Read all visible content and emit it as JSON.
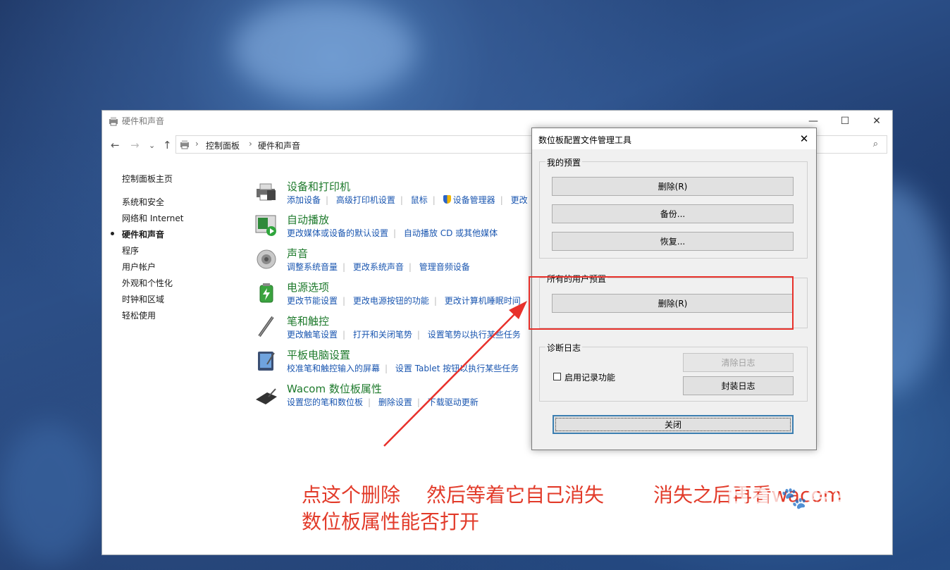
{
  "window": {
    "title": "硬件和声音"
  },
  "address": {
    "crumbs": [
      "控制面板",
      "硬件和声音"
    ]
  },
  "sidebar": {
    "items": [
      {
        "label": "控制面板主页"
      },
      {
        "label": "系统和安全"
      },
      {
        "label": "网络和 Internet"
      },
      {
        "label": "硬件和声音",
        "active": true
      },
      {
        "label": "程序"
      },
      {
        "label": "用户帐户"
      },
      {
        "label": "外观和个性化"
      },
      {
        "label": "时钟和区域"
      },
      {
        "label": "轻松使用"
      }
    ]
  },
  "categories": [
    {
      "title": "设备和打印机",
      "icon": "printer-icon",
      "links": [
        "添加设备",
        "高级打印机设置",
        "鼠标",
        "设备管理器",
        "更改"
      ]
    },
    {
      "title": "自动播放",
      "icon": "autoplay-icon",
      "links": [
        "更改媒体或设备的默认设置",
        "自动播放 CD 或其他媒体"
      ]
    },
    {
      "title": "声音",
      "icon": "speaker-icon",
      "links": [
        "调整系统音量",
        "更改系统声音",
        "管理音频设备"
      ]
    },
    {
      "title": "电源选项",
      "icon": "battery-icon",
      "links": [
        "更改节能设置",
        "更改电源按钮的功能",
        "更改计算机睡眠时间"
      ]
    },
    {
      "title": "笔和触控",
      "icon": "pen-icon",
      "links": [
        "更改触笔设置",
        "打开和关闭笔势",
        "设置笔势以执行某些任务"
      ]
    },
    {
      "title": "平板电脑设置",
      "icon": "tablet-icon",
      "links": [
        "校准笔和触控输入的屏幕",
        "设置 Tablet 按钮以执行某些任务"
      ]
    },
    {
      "title": "Wacom 数位板属性",
      "icon": "wacom-tablet-icon",
      "links": [
        "设置您的笔和数位板",
        "删除设置",
        "下载驱动更新"
      ]
    }
  ],
  "dialog": {
    "title": "数位板配置文件管理工具",
    "my_prefs": {
      "label": "我的预置",
      "delete": "删除(R)",
      "backup": "备份...",
      "restore": "恢复..."
    },
    "all_users": {
      "label": "所有的用户预置",
      "delete": "删除(R)"
    },
    "diag": {
      "label": "诊断日志",
      "enable_logging": "启用记录功能",
      "clear_log": "清除日志",
      "package_log": "封装日志"
    },
    "close": "关闭"
  },
  "annotation": {
    "line1_a": "点这个删除",
    "line1_b": "然后等着它自己消失",
    "line1_c": "消失之后再看wacom",
    "line2": "数位板属性能否打开",
    "color": "#e23b2a"
  },
  "watermark": {
    "brand": "Bai",
    "brand2": "经验",
    "url": "jingyan.baidu.com"
  }
}
